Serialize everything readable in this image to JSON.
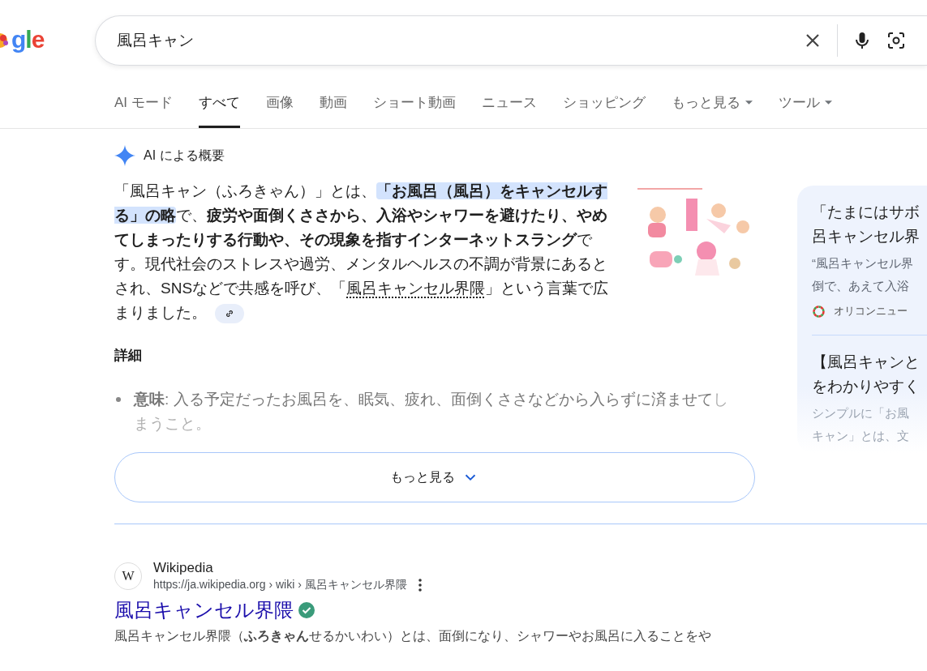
{
  "logo": {
    "text": "gle"
  },
  "search": {
    "value": "風呂キャン"
  },
  "tabs": [
    {
      "label": "AI モード",
      "selected": false,
      "kind": "plain"
    },
    {
      "label": "すべて",
      "selected": true,
      "kind": "plain"
    },
    {
      "label": "画像",
      "selected": false,
      "kind": "plain"
    },
    {
      "label": "動画",
      "selected": false,
      "kind": "plain"
    },
    {
      "label": "ショート動画",
      "selected": false,
      "kind": "plain"
    },
    {
      "label": "ニュース",
      "selected": false,
      "kind": "plain"
    },
    {
      "label": "ショッピング",
      "selected": false,
      "kind": "plain"
    },
    {
      "label": "もっと見る",
      "selected": false,
      "kind": "menu"
    },
    {
      "label": "ツール",
      "selected": false,
      "kind": "menu"
    }
  ],
  "ai_overview": {
    "title": "AI による概要",
    "segments": [
      {
        "kind": "plain",
        "text": "「風呂キャン（ふろきゃん）」とは、"
      },
      {
        "kind": "highlight",
        "text": "「お風呂（風呂）をキャンセルする」の略"
      },
      {
        "kind": "plain",
        "text": "で、"
      },
      {
        "kind": "bold",
        "text": "疲労や面倒くささから、入浴やシャワーを避けたり、やめてしまったりする行動や、その現象を指すインターネットスラング"
      },
      {
        "kind": "plain",
        "text": "です。現代社会のストレスや過労、メンタルヘルスの不調が背景にあるとされ、SNSなどで共感を呼び、「"
      },
      {
        "kind": "link",
        "text": "風呂キャンセル界隈"
      },
      {
        "kind": "plain",
        "text": "」という言葉で広まりました。"
      }
    ],
    "details_heading": "詳細",
    "bullets": [
      {
        "term": "意味",
        "text": ": 入る予定だったお風呂を、眠気、疲れ、面倒くささなどから入らずに済ませて",
        "faded_text": "しまうこと。"
      }
    ],
    "more_button": "もっと見る"
  },
  "sources": [
    {
      "title_lines": [
        "「たまにはサボ",
        "呂キャンセル界"
      ],
      "snippet_lines": [
        "“風呂キャンセル界",
        "倒で、あえて入浴"
      ],
      "site": "オリコンニュー",
      "faded": false
    },
    {
      "title_lines": [
        "【風呂キャンと",
        "をわかりやすく"
      ],
      "snippet_lines": [
        "シンプルに「お風",
        "キャン」とは、文"
      ],
      "faded": true
    }
  ],
  "result": {
    "site_name": "Wikipedia",
    "favicon": "W",
    "url": "https://ja.wikipedia.org › wiki › 風呂キャンセル界隈",
    "title": "風呂キャンセル界隈",
    "verified": true,
    "snippet": "風呂キャンセル界隈（**ふろきゃん**せるかいわい）とは、面倒になり、シャワーやお風呂に入ることをや"
  }
}
